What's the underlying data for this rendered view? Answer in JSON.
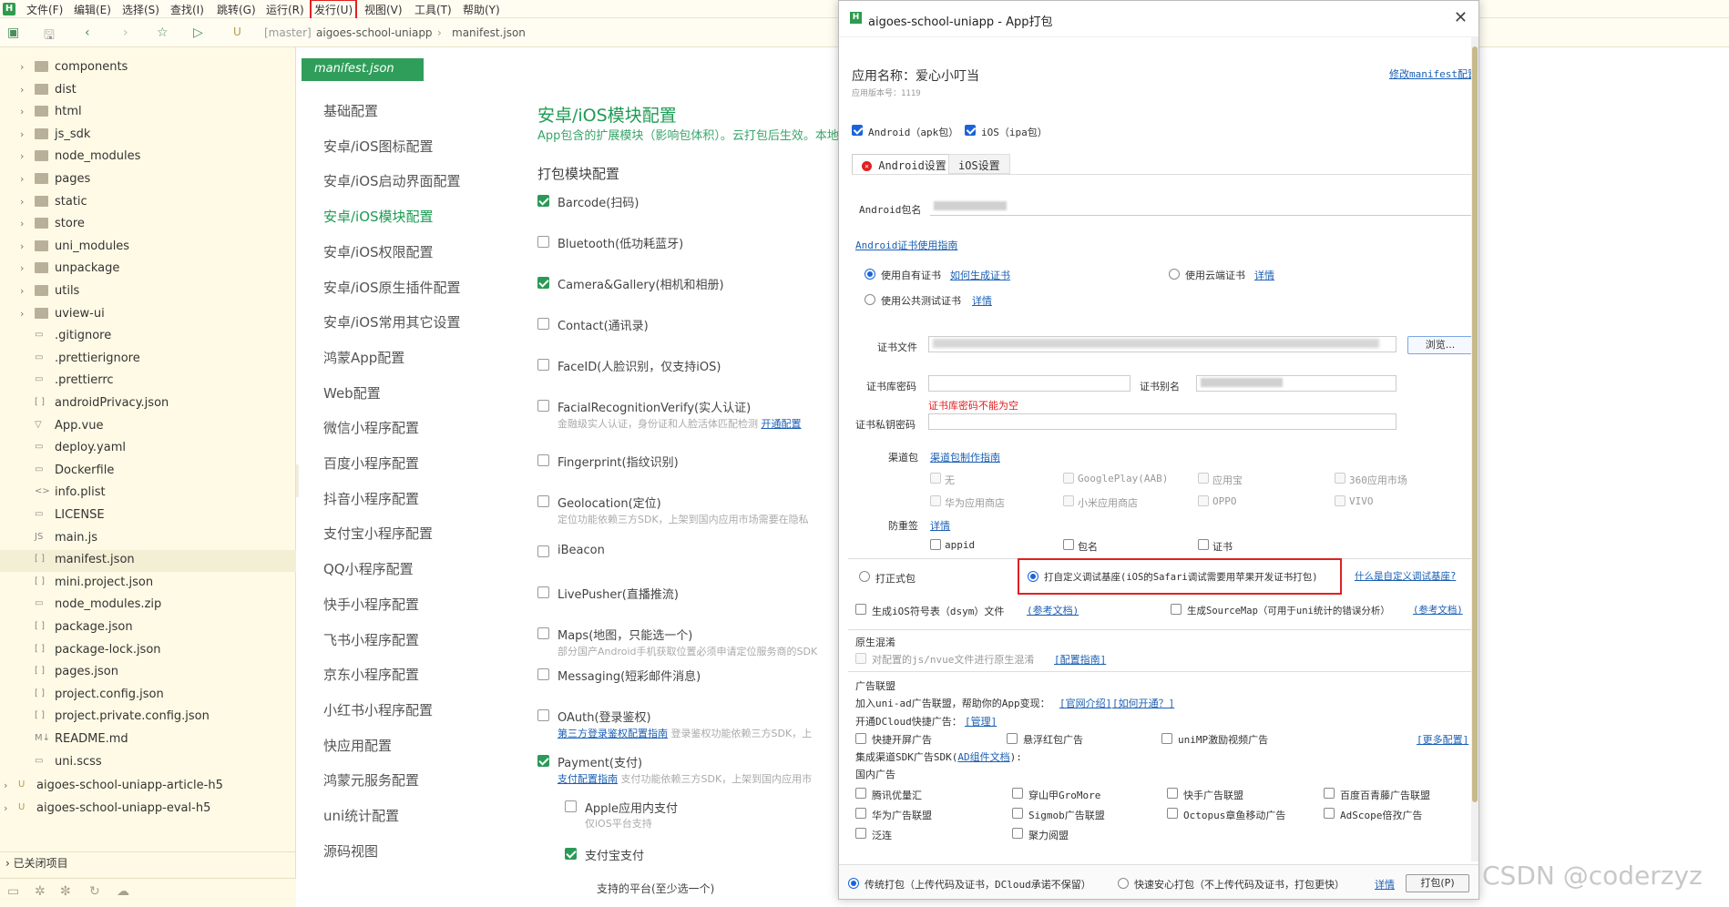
{
  "menubar": {
    "items": [
      "文件(F)",
      "编辑(E)",
      "选择(S)",
      "查找(I)",
      "跳转(G)",
      "运行(R)",
      "发行(U)",
      "视图(V)",
      "工具(T)",
      "帮助(Y)"
    ],
    "highlighted": "发行(U)"
  },
  "toolbar": {
    "branch": "[master]",
    "project": "aigoes-school-uniapp",
    "separator": "›",
    "file": "manifest.json"
  },
  "filetree": {
    "items": [
      {
        "label": "components",
        "type": "folder"
      },
      {
        "label": "dist",
        "type": "folder"
      },
      {
        "label": "html",
        "type": "folder"
      },
      {
        "label": "js_sdk",
        "type": "folder"
      },
      {
        "label": "node_modules",
        "type": "folder"
      },
      {
        "label": "pages",
        "type": "folder"
      },
      {
        "label": "static",
        "type": "folder"
      },
      {
        "label": "store",
        "type": "folder"
      },
      {
        "label": "uni_modules",
        "type": "folder"
      },
      {
        "label": "unpackage",
        "type": "folder"
      },
      {
        "label": "utils",
        "type": "folder"
      },
      {
        "label": "uview-ui",
        "type": "folder"
      },
      {
        "label": ".gitignore",
        "type": "file"
      },
      {
        "label": ".prettierignore",
        "type": "file"
      },
      {
        "label": ".prettierrc",
        "type": "file"
      },
      {
        "label": "androidPrivacy.json",
        "type": "json"
      },
      {
        "label": "App.vue",
        "type": "vue"
      },
      {
        "label": "deploy.yaml",
        "type": "file"
      },
      {
        "label": "Dockerfile",
        "type": "file"
      },
      {
        "label": "info.plist",
        "type": "xml"
      },
      {
        "label": "LICENSE",
        "type": "file"
      },
      {
        "label": "main.js",
        "type": "js"
      },
      {
        "label": "manifest.json",
        "type": "json",
        "active": true
      },
      {
        "label": "mini.project.json",
        "type": "json"
      },
      {
        "label": "node_modules.zip",
        "type": "file"
      },
      {
        "label": "package.json",
        "type": "json"
      },
      {
        "label": "package-lock.json",
        "type": "json"
      },
      {
        "label": "pages.json",
        "type": "json"
      },
      {
        "label": "project.config.json",
        "type": "json"
      },
      {
        "label": "project.private.config.json",
        "type": "json"
      },
      {
        "label": "README.md",
        "type": "md"
      },
      {
        "label": "uni.scss",
        "type": "file"
      }
    ],
    "projects": [
      "aigoes-school-uniapp-article-h5",
      "aigoes-school-uniapp-eval-h5"
    ],
    "closed_projects": "已关闭项目"
  },
  "manifest": {
    "tab": "manifest.json",
    "nav": [
      "基础配置",
      "安卓/iOS图标配置",
      "安卓/iOS启动界面配置",
      "安卓/iOS模块配置",
      "安卓/iOS权限配置",
      "安卓/iOS原生插件配置",
      "安卓/iOS常用其它设置",
      "鸿蒙App配置",
      "Web配置",
      "微信小程序配置",
      "百度小程序配置",
      "抖音小程序配置",
      "支付宝小程序配置",
      "QQ小程序配置",
      "快手小程序配置",
      "飞书小程序配置",
      "京东小程序配置",
      "小红书小程序配置",
      "快应用配置",
      "鸿蒙元服务配置",
      "uni统计配置",
      "源码视图"
    ],
    "selected_nav": "安卓/iOS模块配置",
    "title": "安卓/iOS模块配置",
    "subtitle": "App包含的扩展模块（影响包体积）。云打包后生效。本地",
    "section": "打包模块配置",
    "modules": [
      {
        "label": "Barcode(扫码)",
        "checked": true
      },
      {
        "label": "Bluetooth(低功耗蓝牙)",
        "checked": false
      },
      {
        "label": "Camera&Gallery(相机和相册)",
        "checked": true
      },
      {
        "label": "Contact(通讯录)",
        "checked": false
      },
      {
        "label": "FaceID(人脸识别，仅支持iOS)",
        "checked": false
      },
      {
        "label": "FacialRecognitionVerify(实人认证)",
        "checked": false,
        "note": "金融级实人认证，身份证和人脸活体匹配检测",
        "note_link": "开通配置"
      },
      {
        "label": "Fingerprint(指纹识别)",
        "checked": false
      },
      {
        "label": "Geolocation(定位)",
        "checked": false,
        "note": "定位功能依赖三方SDK，上架到国内应用市场需要在隐私"
      },
      {
        "label": "iBeacon",
        "checked": false
      },
      {
        "label": "LivePusher(直播推流)",
        "checked": false
      },
      {
        "label": "Maps(地图，只能选一个)",
        "checked": false,
        "note": "部分国产Android手机获取位置必须申请定位服务商的SDK"
      },
      {
        "label": "Messaging(短彩邮件消息)",
        "checked": false
      },
      {
        "label": "OAuth(登录鉴权)",
        "checked": false,
        "note_link": "第三方登录鉴权配置指南",
        "note": "登录鉴权功能依赖三方SDK，上"
      },
      {
        "label": "Payment(支付)",
        "checked": true,
        "note_link": "支付配置指南",
        "note": "支付功能依赖三方SDK，上架到国内应用市"
      }
    ],
    "sub_modules": [
      {
        "label": "Apple应用内支付",
        "checked": false,
        "note": "仅iOS平台支持"
      },
      {
        "label": "支付宝支付",
        "checked": true
      }
    ],
    "platforms_label": "支持的平台(至少选一个)"
  },
  "dialog": {
    "title": "aigoes-school-uniapp - App打包",
    "app_name_label": "应用名称：爱心小叮当",
    "version_label": "应用版本号：1119",
    "modify_link": "修改manifest配置",
    "android_check": "Android（apk包）",
    "ios_check": "iOS（ipa包）",
    "tabs": [
      "Android设置",
      "iOS设置"
    ],
    "package_label": "Android包名",
    "cert_guide": "Android证书使用指南",
    "cert_options": [
      {
        "label": "使用自有证书",
        "link": "如何生成证书",
        "selected": true
      },
      {
        "label": "使用云端证书",
        "link": "详情",
        "selected": false
      },
      {
        "label": "使用公共测试证书",
        "link": "详情",
        "selected": false
      }
    ],
    "cert_file_label": "证书文件",
    "browse": "浏览...",
    "keystore_pwd_label": "证书库密码",
    "alias_label": "证书别名",
    "pwd_error": "证书库密码不能为空",
    "private_pwd_label": "证书私钥密码",
    "channel_label": "渠道包",
    "channel_link": "渠道包制作指南",
    "channels": [
      "无",
      "GooglePlay(AAB)",
      "应用宝",
      "360应用市场",
      "华为应用商店",
      "小米应用商店",
      "OPPO",
      "VIVO"
    ],
    "anti_label": "防重签",
    "anti_link": "详情",
    "anti_options": [
      "appid",
      "包名",
      "证书"
    ],
    "release_option": "打正式包",
    "custom_base_option": "打自定义调试基座(iOS的Safari调试需要用苹果开发证书打包)",
    "custom_base_link": "什么是自定义调试基座?",
    "dsym_label": "生成iOS符号表（dsym）文件",
    "dsym_link": "(参考文档)",
    "sourcemap_label": "生成SourceMap（可用于uni统计的错误分析）",
    "sourcemap_link": "(参考文档)",
    "obf_title": "原生混淆",
    "obf_label": "对配置的js/nvue文件进行原生混淆",
    "obf_link": "[配置指南]",
    "ad_title": "广告联盟",
    "ad_join": "加入uni-ad广告联盟，帮助你的App变现：",
    "ad_intro": "[官网介绍]",
    "ad_how": "[如何开通？]",
    "ad_quick_label": "开通DCloud快捷广告：",
    "ad_manage": "[管理]",
    "ad_quick": [
      "快捷开屏广告",
      "悬浮红包广告",
      "uniMP激励视频广告"
    ],
    "ad_more": "[更多配置]",
    "sdk_label": "集成渠道SDK广告SDK(",
    "sdk_link": "AD组件文档",
    "sdk_end": "):",
    "domestic": "国内广告",
    "ad_sdks": [
      "腾讯优量汇",
      "穿山甲GroMore",
      "快手广告联盟",
      "百度百青藤广告联盟",
      "华为广告联盟",
      "Sigmob广告联盟",
      "Octopus章鱼移动广告",
      "AdScope倍孜广告",
      "泛连",
      "聚力阅盟"
    ],
    "bottom_options": [
      {
        "label": "传统打包（上传代码及证书，DCloud承诺不保留）",
        "selected": true
      },
      {
        "label": "快速安心打包（不上传代码及证书，打包更快）",
        "selected": false
      }
    ],
    "bottom_link": "详情",
    "pack_button": "打包(P)"
  },
  "watermark": "CSDN @coderzyz"
}
